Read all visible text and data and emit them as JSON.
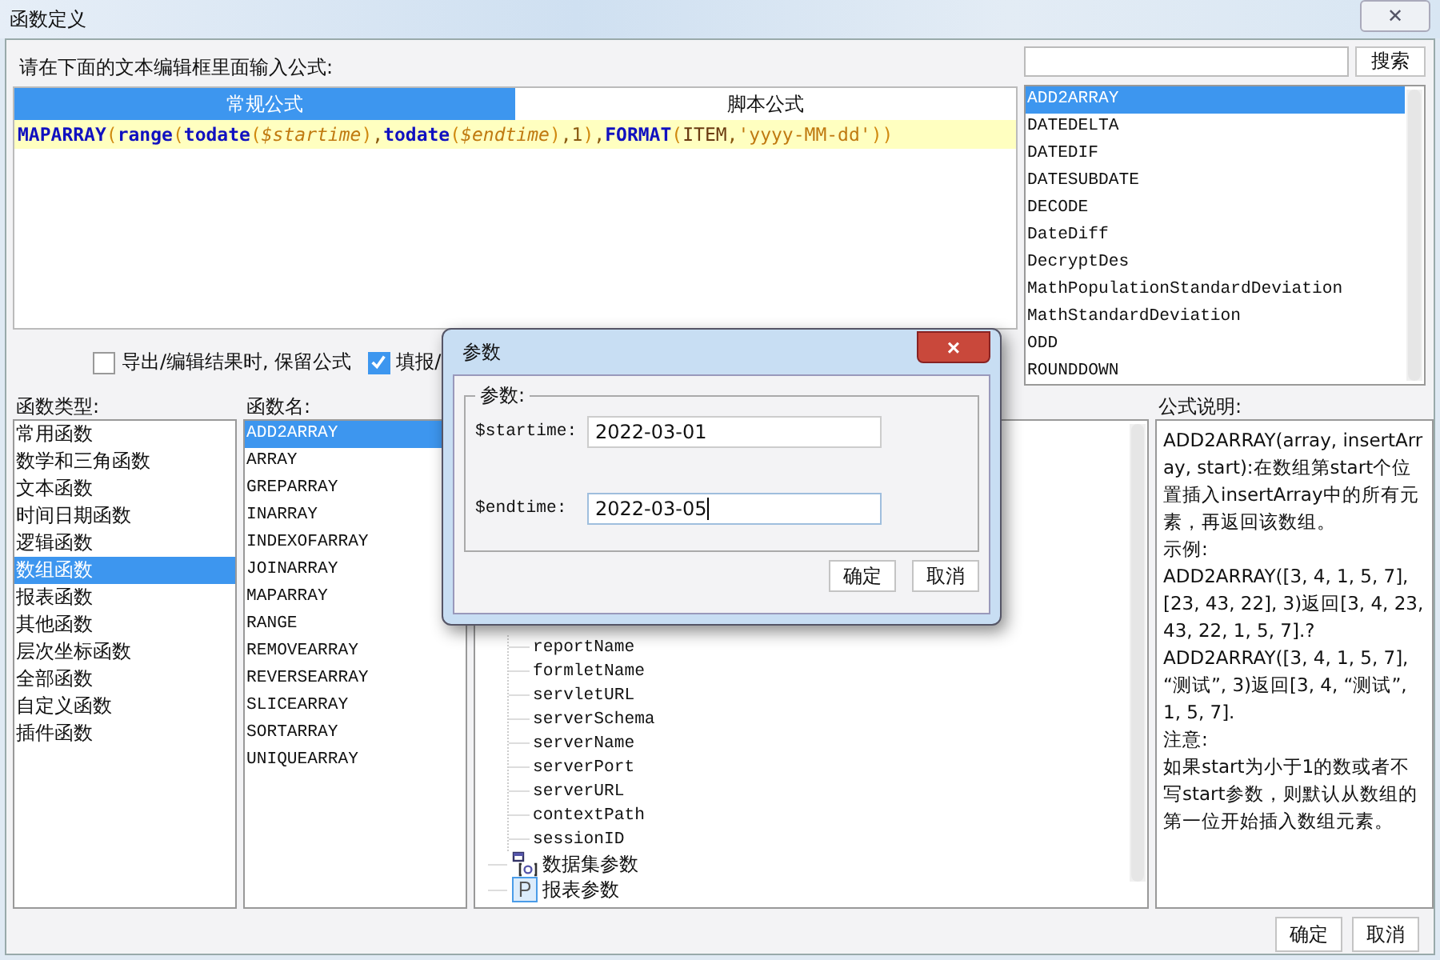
{
  "window": {
    "title": "函数定义",
    "close": "✕"
  },
  "prompt": "请在下面的文本编辑框里面输入公式:",
  "tabs": [
    {
      "label": "常规公式",
      "selected": true
    },
    {
      "label": "脚本公式",
      "selected": false
    }
  ],
  "formula": [
    {
      "kind": "func",
      "text": "MAPARRAY"
    },
    {
      "kind": "paren",
      "text": "("
    },
    {
      "kind": "func",
      "text": "range"
    },
    {
      "kind": "paren",
      "text": "("
    },
    {
      "kind": "func",
      "text": "todate"
    },
    {
      "kind": "paren",
      "text": "("
    },
    {
      "kind": "var",
      "text": "$startime"
    },
    {
      "kind": "paren",
      "text": ")"
    },
    {
      "kind": "punct",
      "text": ","
    },
    {
      "kind": "func",
      "text": "todate"
    },
    {
      "kind": "paren",
      "text": "("
    },
    {
      "kind": "var",
      "text": "$endtime"
    },
    {
      "kind": "paren",
      "text": ")"
    },
    {
      "kind": "punct",
      "text": ",1"
    },
    {
      "kind": "paren",
      "text": ")"
    },
    {
      "kind": "punct",
      "text": ","
    },
    {
      "kind": "func",
      "text": "FORMAT"
    },
    {
      "kind": "paren",
      "text": "("
    },
    {
      "kind": "plain",
      "text": "ITEM"
    },
    {
      "kind": "punct",
      "text": ","
    },
    {
      "kind": "string",
      "text": "'yyyy-MM-dd'"
    },
    {
      "kind": "paren",
      "text": "))"
    }
  ],
  "search": {
    "button": "搜索"
  },
  "search_results": [
    {
      "label": "ADD2ARRAY",
      "selected": true
    },
    {
      "label": "DATEDELTA",
      "selected": false
    },
    {
      "label": "DATEDIF",
      "selected": false
    },
    {
      "label": "DATESUBDATE",
      "selected": false
    },
    {
      "label": "DECODE",
      "selected": false
    },
    {
      "label": "DateDiff",
      "selected": false
    },
    {
      "label": "DecryptDes",
      "selected": false
    },
    {
      "label": "MathPopulationStandardDeviation",
      "selected": false
    },
    {
      "label": "MathStandardDeviation",
      "selected": false
    },
    {
      "label": "ODD",
      "selected": false
    },
    {
      "label": "ROUNDDOWN",
      "selected": false
    }
  ],
  "options": [
    {
      "label": "导出/编辑结果时, 保留公式",
      "checked": false
    },
    {
      "label": "填报/",
      "checked": true
    }
  ],
  "function_types": {
    "label": "函数类型:",
    "items": [
      {
        "label": "常用函数",
        "selected": false
      },
      {
        "label": "数学和三角函数",
        "selected": false
      },
      {
        "label": "文本函数",
        "selected": false
      },
      {
        "label": "时间日期函数",
        "selected": false
      },
      {
        "label": "逻辑函数",
        "selected": false
      },
      {
        "label": "数组函数",
        "selected": true
      },
      {
        "label": "报表函数",
        "selected": false
      },
      {
        "label": "其他函数",
        "selected": false
      },
      {
        "label": "层次坐标函数",
        "selected": false
      },
      {
        "label": "全部函数",
        "selected": false
      },
      {
        "label": "自定义函数",
        "selected": false
      },
      {
        "label": "插件函数",
        "selected": false
      }
    ]
  },
  "function_names": {
    "label": "函数名:",
    "items": [
      {
        "label": "ADD2ARRAY",
        "selected": true
      },
      {
        "label": "ARRAY",
        "selected": false
      },
      {
        "label": "GREPARRAY",
        "selected": false
      },
      {
        "label": "INARRAY",
        "selected": false
      },
      {
        "label": "INDEXOFARRAY",
        "selected": false
      },
      {
        "label": "JOINARRAY",
        "selected": false
      },
      {
        "label": "MAPARRAY",
        "selected": false
      },
      {
        "label": "RANGE",
        "selected": false
      },
      {
        "label": "REMOVEARRAY",
        "selected": false
      },
      {
        "label": "REVERSEARRAY",
        "selected": false
      },
      {
        "label": "SLICEARRAY",
        "selected": false
      },
      {
        "label": "SORTARRAY",
        "selected": false
      },
      {
        "label": "UNIQUEARRAY",
        "selected": false
      }
    ]
  },
  "tree": [
    {
      "children": [
        {
          "label": "reportName"
        },
        {
          "label": "formletName"
        },
        {
          "label": "servletURL"
        },
        {
          "label": "serverSchema"
        },
        {
          "label": "serverName"
        },
        {
          "label": "serverPort"
        },
        {
          "label": "serverURL"
        },
        {
          "label": "contextPath"
        },
        {
          "label": "sessionID"
        }
      ]
    },
    {
      "label": "数据集参数",
      "kind": "dataset"
    },
    {
      "label": "报表参数",
      "kind": "param"
    }
  ],
  "description": {
    "label": "公式说明:",
    "paragraphs": [
      "ADD2ARRAY(array, insertArray, start):在数组第start个位置插入insertArray中的所有元素，再返回该数组。",
      "示例:",
      "ADD2ARRAY([3, 4, 1, 5, 7], [23, 43, 22], 3)返回[3, 4, 23, 43, 22, 1, 5, 7].?",
      "ADD2ARRAY([3, 4, 1, 5, 7], “测试”, 3)返回[3, 4, “测试”, 1, 5, 7].",
      "注意:",
      "如果start为小于1的数或者不写start参数，则默认从数组的第一位开始插入数组元素。"
    ]
  },
  "buttons": [
    "确定",
    "取消"
  ],
  "dialog": {
    "title": "参数",
    "close": "×",
    "group": "参数:",
    "fields": [
      {
        "label": "$startime:",
        "value": "2022-03-01",
        "focused": false
      },
      {
        "label": "$endtime:",
        "value": "2022-03-05",
        "focused": true
      }
    ],
    "buttons": [
      "确定",
      "取消"
    ]
  }
}
